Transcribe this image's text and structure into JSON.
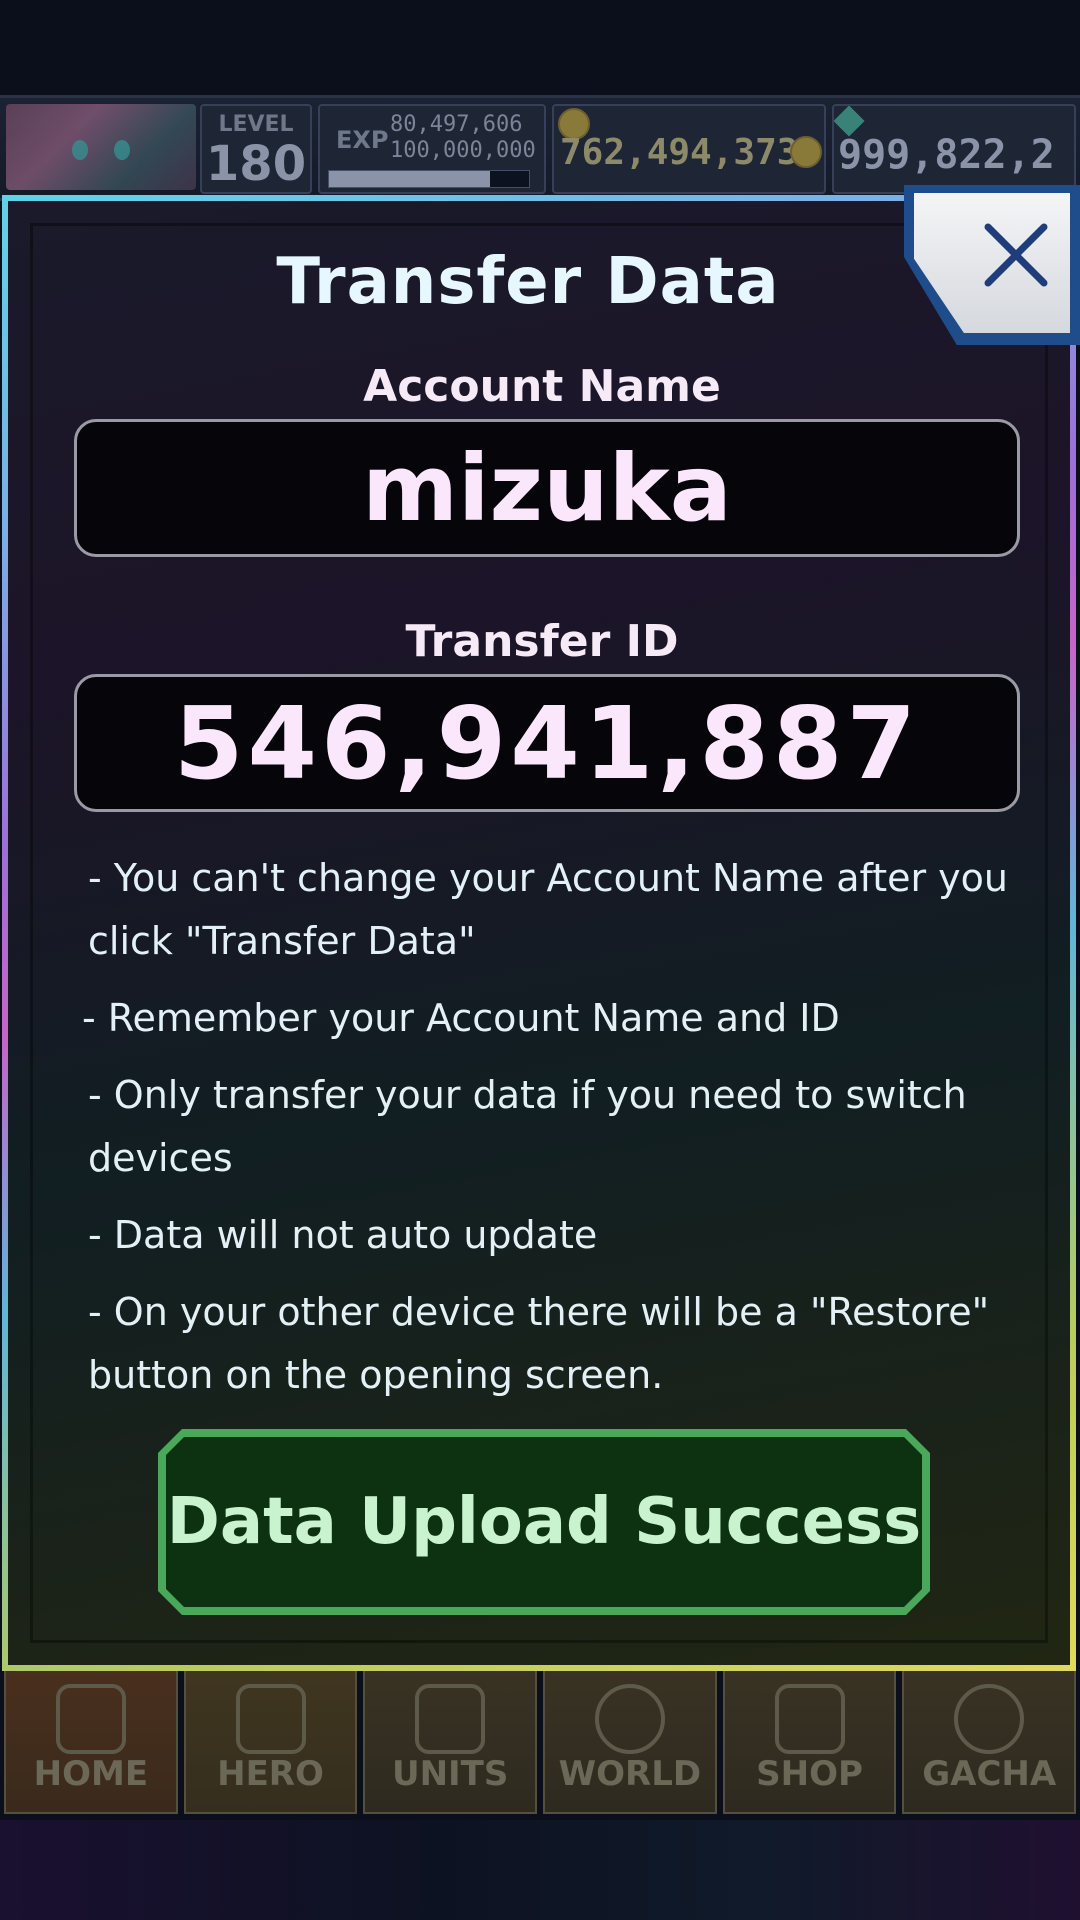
{
  "hud": {
    "level_label": "LEVEL",
    "level_value": "180",
    "exp_label": "EXP",
    "exp_current": "80,497,606",
    "exp_max": "100,000,000",
    "exp_progress": 0.805,
    "gold": "762,494,373",
    "gems": "999,822,2"
  },
  "nav": {
    "items": [
      {
        "label": "HOME"
      },
      {
        "label": "HERO"
      },
      {
        "label": "UNITS"
      },
      {
        "label": "WORLD"
      },
      {
        "label": "SHOP"
      },
      {
        "label": "GACHA"
      }
    ]
  },
  "dialog": {
    "title": "Transfer Data",
    "account_label": "Account Name",
    "account_value": "mizuka",
    "transfer_id_label": "Transfer ID",
    "transfer_id_value": "546,941,887",
    "notes": [
      "- You can't change your Account Name after you click \"Transfer Data\"",
      "- Remember your Account Name and ID",
      "- Only transfer your data if you need to switch devices",
      "- Data will not auto update",
      "- On your other device there will be a \"Restore\" button on the opening screen."
    ],
    "success_button": "Data Upload Success",
    "close_icon": "close-icon"
  },
  "colors": {
    "success_green": "#0d3212",
    "success_border": "#4aa85a",
    "close_button_blue": "#1f4d8c"
  }
}
